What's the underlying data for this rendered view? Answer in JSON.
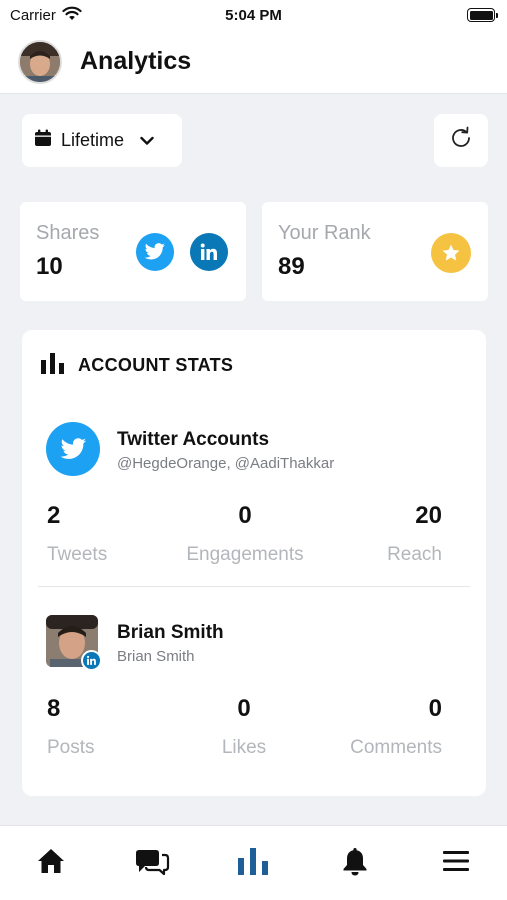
{
  "status_bar": {
    "carrier": "Carrier",
    "time": "5:04 PM"
  },
  "header": {
    "title": "Analytics"
  },
  "filter": {
    "selected": "Lifetime"
  },
  "stats": {
    "shares": {
      "label": "Shares",
      "value": "10"
    },
    "rank": {
      "label": "Your Rank",
      "value": "89"
    }
  },
  "account_stats": {
    "title": "ACCOUNT STATS",
    "twitter": {
      "name": "Twitter Accounts",
      "handles": "@HegdeOrange, @AadiThakkar",
      "metrics": [
        {
          "value": "2",
          "label": "Tweets"
        },
        {
          "value": "0",
          "label": "Engagements"
        },
        {
          "value": "20",
          "label": "Reach"
        }
      ]
    },
    "linkedin": {
      "name": "Brian Smith",
      "sub": "Brian Smith",
      "metrics": [
        {
          "value": "8",
          "label": "Posts"
        },
        {
          "value": "0",
          "label": "Likes"
        },
        {
          "value": "0",
          "label": "Comments"
        }
      ]
    }
  },
  "colors": {
    "twitter": "#1da1f2",
    "linkedin": "#0a78b7",
    "star": "#f5c242",
    "nav_active": "#1f5f99"
  },
  "nav": {
    "items": [
      "home-icon",
      "messages-icon",
      "analytics-icon",
      "bell-icon",
      "menu-icon"
    ],
    "active": "analytics-icon"
  }
}
